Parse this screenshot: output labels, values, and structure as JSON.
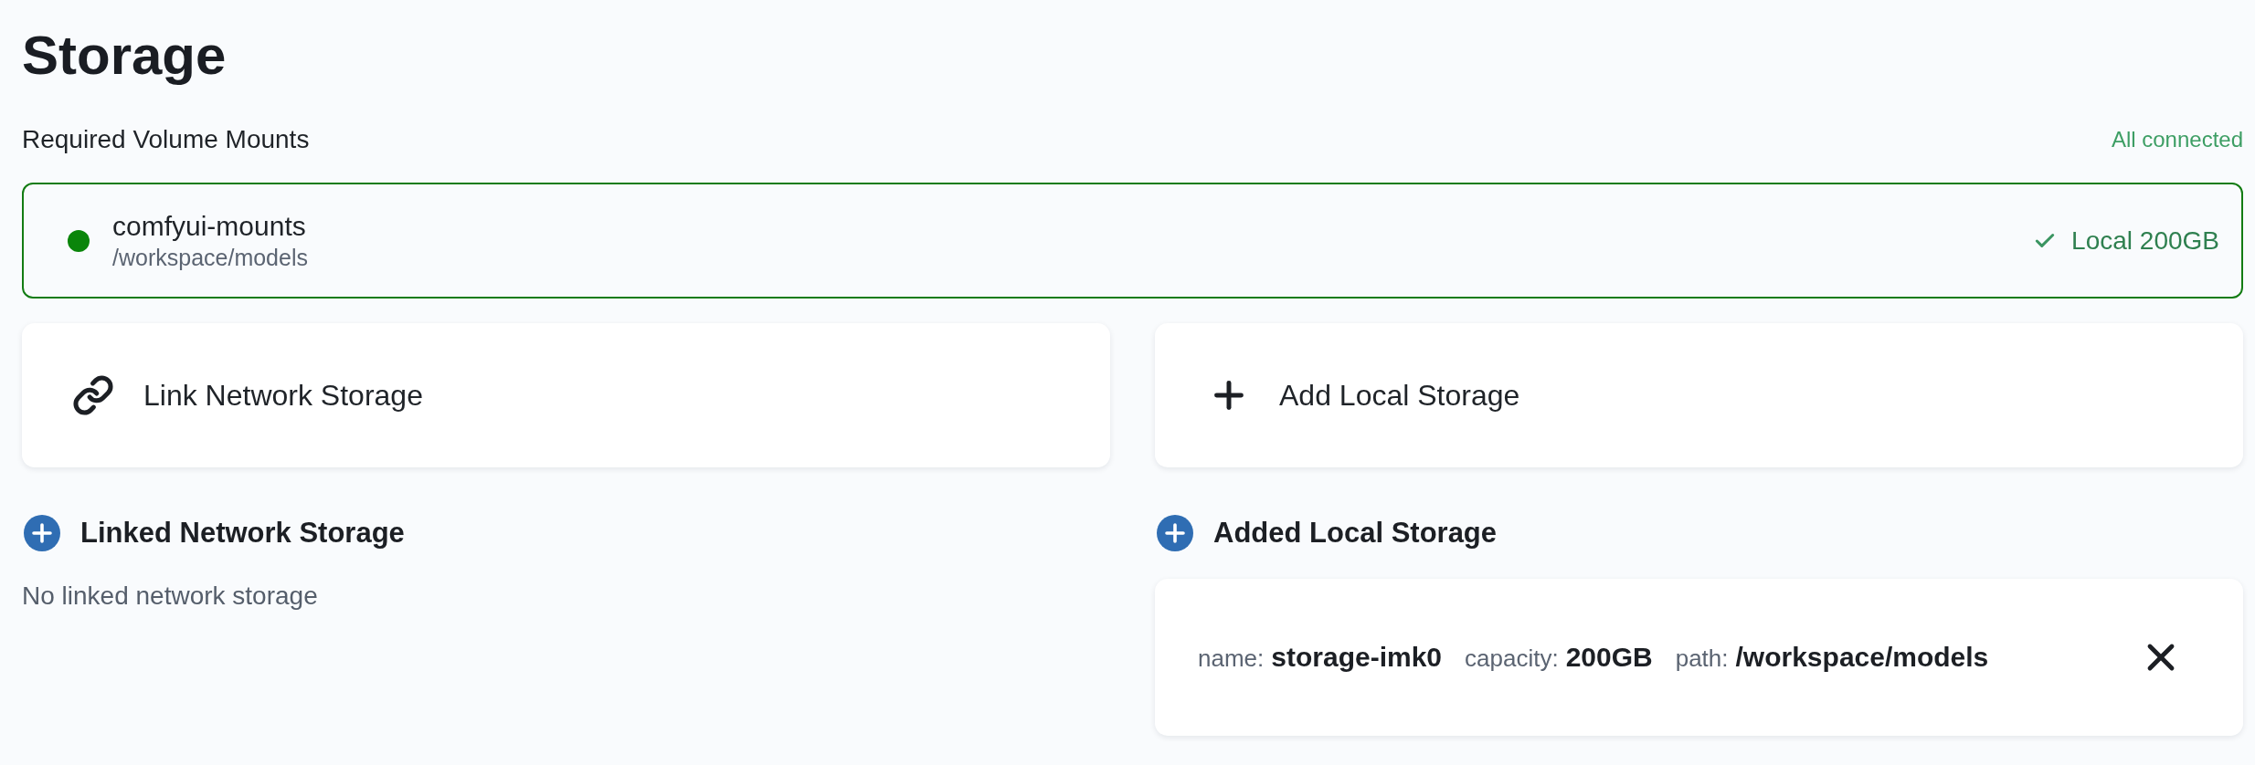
{
  "title": "Storage",
  "required_mounts": {
    "label": "Required Volume Mounts",
    "status": "All connected",
    "items": [
      {
        "name": "comfyui-mounts",
        "path": "/workspace/models",
        "connected": true,
        "status": "Local 200GB"
      }
    ]
  },
  "actions": [
    {
      "kind": "link",
      "label": "Link Network Storage"
    },
    {
      "kind": "add",
      "label": "Add Local Storage"
    }
  ],
  "sections": [
    {
      "title": "Linked Network Storage",
      "empty_text": "No linked network storage"
    },
    {
      "title": "Added Local Storage",
      "items": [
        {
          "fields": [
            {
              "label": "name:",
              "value": "storage-imk0"
            },
            {
              "label": "capacity:",
              "value": "200GB"
            },
            {
              "label": "path:",
              "value": "/workspace/models"
            }
          ]
        }
      ]
    }
  ]
}
